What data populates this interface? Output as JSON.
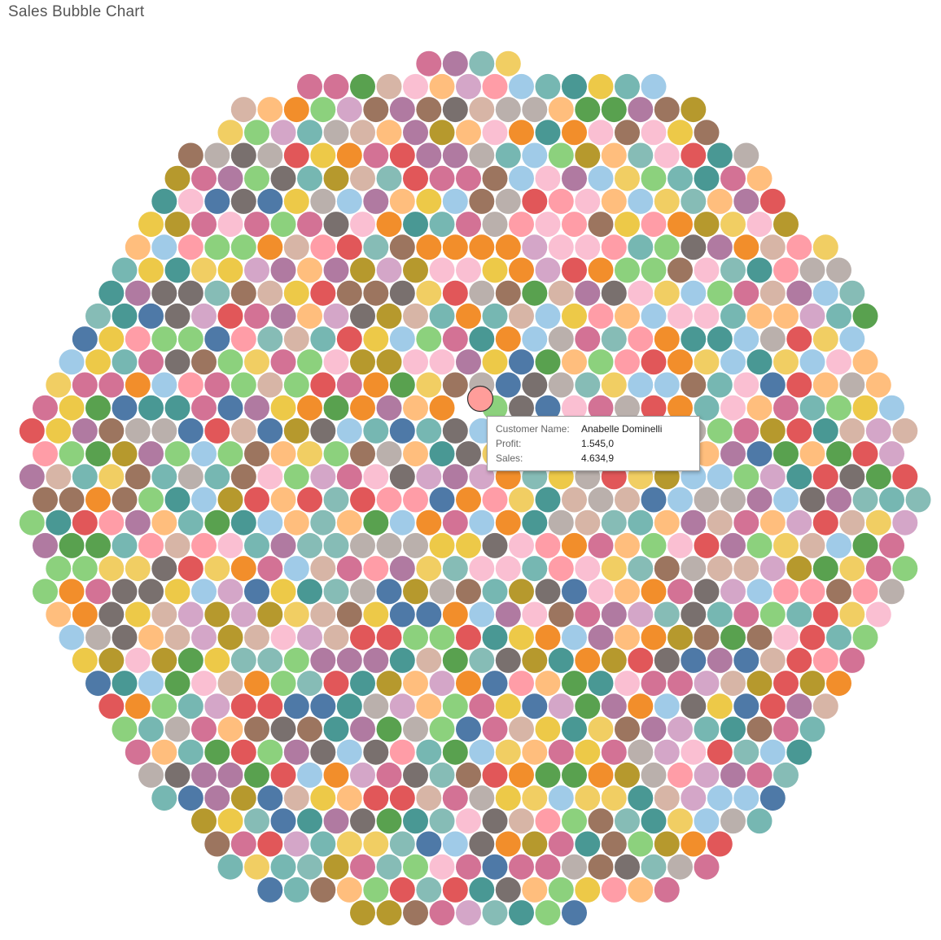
{
  "title": "Sales Bubble Chart",
  "palette": [
    "#e15759",
    "#4e79a7",
    "#f28e2b",
    "#59a14f",
    "#76b7b2",
    "#edc948",
    "#b07aa1",
    "#ff9da7",
    "#9c755f",
    "#bab0ac",
    "#8cd17d",
    "#b6992d",
    "#499894",
    "#86bcb6",
    "#d37295",
    "#fabfd2",
    "#d4a6c8",
    "#a0cbe8",
    "#ffbe7d",
    "#d7b5a6",
    "#79706e",
    "#f1ce63"
  ],
  "highlight_color": "#ff9d9a",
  "chart_data": {
    "type": "packed-bubble",
    "title": "Sales Bubble Chart",
    "dimension": "Customer Name",
    "measures": [
      "Profit",
      "Sales"
    ],
    "color_by": "Customer Name",
    "highlighted": {
      "customer_name": "Anabelle Dominelli",
      "profit": 1545.0,
      "sales": 4634.9
    }
  },
  "tooltip": {
    "rows": [
      {
        "key": "Customer Name:",
        "value": "Anabelle Dominelli"
      },
      {
        "key": "Profit:",
        "value": "1.545,0"
      },
      {
        "key": "Sales:",
        "value": "4.634,9"
      }
    ]
  }
}
